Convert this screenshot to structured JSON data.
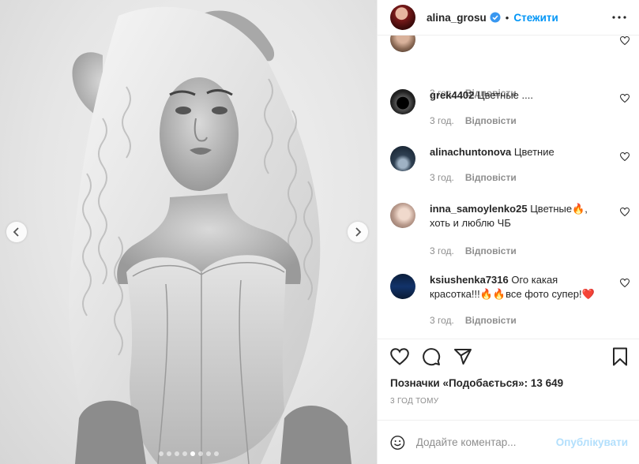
{
  "header": {
    "username": "alina_grosu",
    "separator": "•",
    "follow_label": "Стежити"
  },
  "comments": [
    {
      "author": "",
      "text": "",
      "time": "3 год.",
      "reply_label": "Відповісти"
    },
    {
      "author": "grek4402",
      "text": "Цветные ....",
      "time": "3 год.",
      "reply_label": "Відповісти"
    },
    {
      "author": "alinachuntonova",
      "text": "Цветние",
      "time": "3 год.",
      "reply_label": "Відповісти"
    },
    {
      "author": "inna_samoylenko25",
      "text": "Цветные🔥, хоть и люблю ЧБ",
      "time": "3 год.",
      "reply_label": "Відповісти"
    },
    {
      "author": "ksiushenka7316",
      "text": "Ого какая красотка!!!🔥🔥все фото супер!❤️",
      "time": "3 год.",
      "reply_label": "Відповісти"
    }
  ],
  "likes": {
    "label": "Позначки «Подобається»: 13 649"
  },
  "time_ago": "3 ГОД ТОМУ",
  "add_comment": {
    "placeholder": "Додайте коментар...",
    "publish_label": "Опублікувати"
  },
  "carousel": {
    "total_slides": 8,
    "active_slide": 5
  },
  "colors": {
    "accent": "#0095f6",
    "publish_disabled": "#b2dffc",
    "muted": "#8e8e8e"
  }
}
